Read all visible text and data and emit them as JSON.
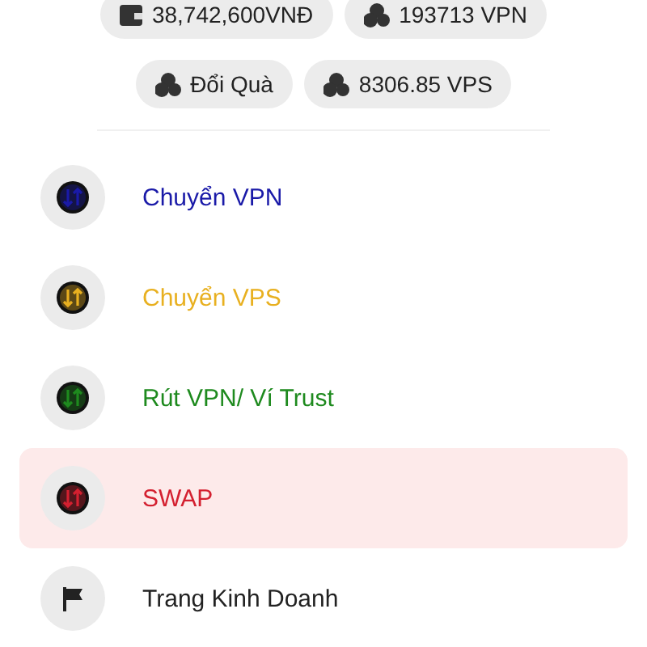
{
  "balances": [
    [
      {
        "kind": "wallet",
        "text": "38,742,600VNĐ"
      },
      {
        "kind": "coins",
        "text": "193713 VPN"
      }
    ],
    [
      {
        "kind": "coins",
        "text": "Đổi Quà"
      },
      {
        "kind": "coins",
        "text": "8306.85 VPS"
      }
    ]
  ],
  "menu": [
    {
      "kind": "transfer",
      "label": "Chuyển VPN",
      "color": "#1a1aa8",
      "selected": false
    },
    {
      "kind": "transfer",
      "label": "Chuyển VPS",
      "color": "#e8b020",
      "selected": false
    },
    {
      "kind": "transfer",
      "label": "Rút VPN/ Ví Trust",
      "color": "#1e8a1e",
      "selected": false
    },
    {
      "kind": "transfer",
      "label": "SWAP",
      "color": "#d42030",
      "selected": true
    },
    {
      "kind": "flag",
      "label": "Trang Kinh Doanh",
      "color": "#222222",
      "selected": false
    }
  ]
}
